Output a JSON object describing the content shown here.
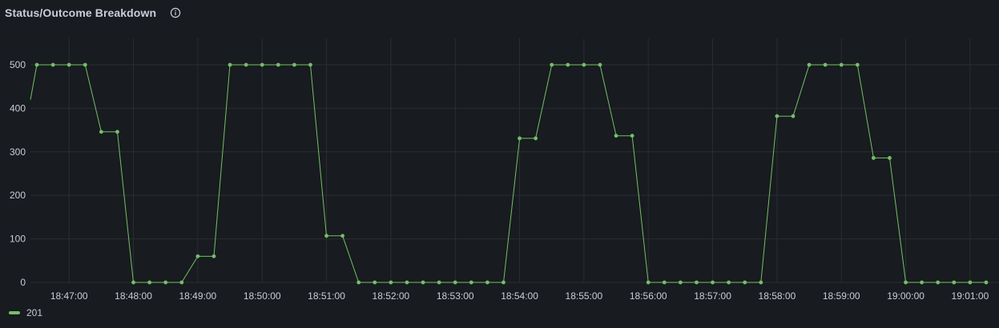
{
  "panel": {
    "title": "Status/Outcome Breakdown",
    "info_icon": "info-circle-icon"
  },
  "chart_data": {
    "type": "line",
    "title": "Status/Outcome Breakdown",
    "xlabel": "",
    "ylabel": "",
    "ylim": [
      0,
      550
    ],
    "yticks": [
      0,
      100,
      200,
      300,
      400,
      500
    ],
    "xticks": [
      "18:47:00",
      "18:48:00",
      "18:49:00",
      "18:50:00",
      "18:51:00",
      "18:52:00",
      "18:53:00",
      "18:54:00",
      "18:55:00",
      "18:56:00",
      "18:57:00",
      "18:58:00",
      "18:59:00",
      "19:00:00",
      "19:01:00"
    ],
    "xlim": [
      "18:46:24",
      "19:01:18"
    ],
    "grid": true,
    "legend": "bottom-left",
    "series": [
      {
        "name": "201",
        "color": "#73bf69",
        "x": [
          "18:46:24",
          "18:46:30",
          "18:46:45",
          "18:47:00",
          "18:47:15",
          "18:47:30",
          "18:47:45",
          "18:48:00",
          "18:48:15",
          "18:48:30",
          "18:48:45",
          "18:49:00",
          "18:49:15",
          "18:49:30",
          "18:49:45",
          "18:50:00",
          "18:50:15",
          "18:50:30",
          "18:50:45",
          "18:51:00",
          "18:51:15",
          "18:51:30",
          "18:51:45",
          "18:52:00",
          "18:52:15",
          "18:52:30",
          "18:52:45",
          "18:53:00",
          "18:53:15",
          "18:53:30",
          "18:53:45",
          "18:54:00",
          "18:54:15",
          "18:54:30",
          "18:54:45",
          "18:55:00",
          "18:55:15",
          "18:55:30",
          "18:55:45",
          "18:56:00",
          "18:56:15",
          "18:56:30",
          "18:56:45",
          "18:57:00",
          "18:57:15",
          "18:57:30",
          "18:57:45",
          "18:58:00",
          "18:58:15",
          "18:58:30",
          "18:58:45",
          "18:59:00",
          "18:59:15",
          "18:59:30",
          "18:59:45",
          "19:00:00",
          "19:00:15",
          "19:00:30",
          "19:00:45",
          "19:01:00",
          "19:01:15"
        ],
        "values": [
          420,
          500,
          500,
          500,
          500,
          346,
          346,
          0,
          0,
          0,
          0,
          60,
          60,
          500,
          500,
          500,
          500,
          500,
          500,
          107,
          107,
          0,
          0,
          0,
          0,
          0,
          0,
          0,
          0,
          0,
          0,
          331,
          331,
          500,
          500,
          500,
          500,
          337,
          337,
          0,
          0,
          0,
          0,
          0,
          0,
          0,
          0,
          382,
          382,
          500,
          500,
          500,
          500,
          286,
          286,
          0,
          0,
          0,
          0,
          0,
          0
        ],
        "markers": [
          false,
          true,
          true,
          true,
          true,
          true,
          true,
          true,
          true,
          true,
          true,
          true,
          true,
          true,
          true,
          true,
          true,
          true,
          true,
          true,
          true,
          true,
          true,
          true,
          true,
          true,
          true,
          true,
          true,
          true,
          true,
          true,
          true,
          true,
          true,
          true,
          true,
          true,
          true,
          true,
          true,
          true,
          true,
          true,
          true,
          true,
          true,
          true,
          true,
          true,
          true,
          true,
          true,
          true,
          true,
          true,
          true,
          true,
          true,
          true,
          true
        ]
      }
    ]
  },
  "legend": {
    "items": [
      {
        "label": "201",
        "color": "#73bf69"
      }
    ]
  }
}
